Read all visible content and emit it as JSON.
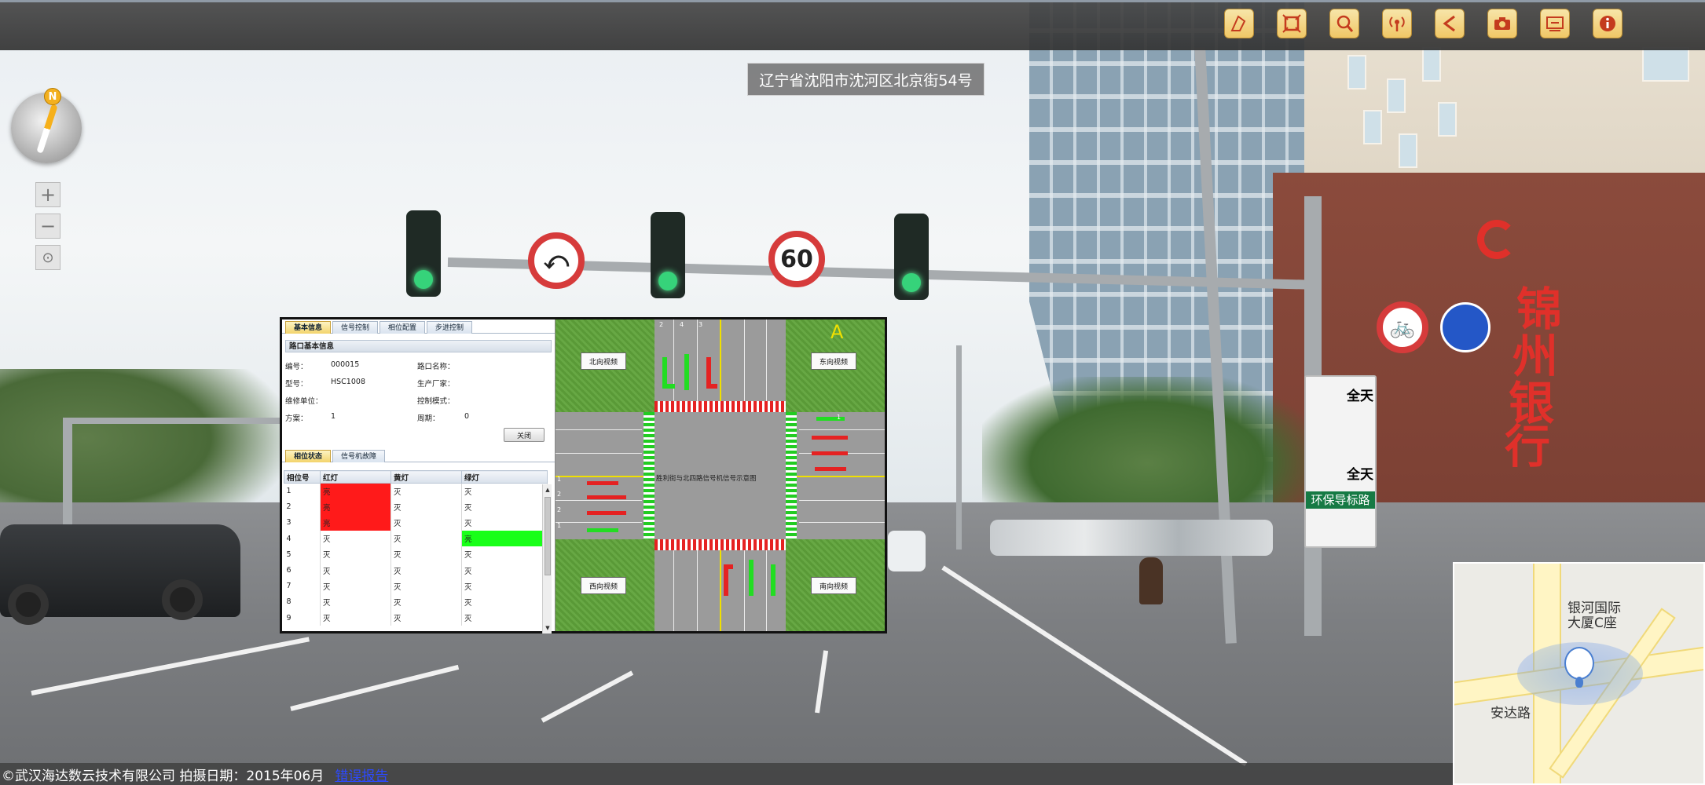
{
  "toolbar": {
    "buttons": [
      {
        "name": "measure-icon"
      },
      {
        "name": "fullscreen-icon"
      },
      {
        "name": "search-zoom-icon"
      },
      {
        "name": "broadcast-icon"
      },
      {
        "name": "share-icon"
      },
      {
        "name": "camera-icon"
      },
      {
        "name": "settings-panel-icon"
      },
      {
        "name": "info-icon"
      }
    ]
  },
  "address": "辽宁省沈阳市沈河区北京街54号",
  "compass": {
    "north_label": "N"
  },
  "zoom": {
    "in": "+",
    "out": "−",
    "reset": "⊙"
  },
  "street_signs": {
    "speed_limit": "60",
    "all_day_1": "全天",
    "all_day_2": "全天",
    "env_lane": "环保导标路"
  },
  "bank_sign": [
    "锦",
    "州",
    "银",
    "行"
  ],
  "signal_panel": {
    "tabs": [
      "基本信息",
      "信号控制",
      "相位配置",
      "步进控制"
    ],
    "section_title": "路口基本信息",
    "fields": {
      "number_label": "编号：",
      "number_value": "000015",
      "crossing_name_label": "路口名称：",
      "crossing_name_value": "",
      "model_label": "型号：",
      "model_value": "HSC1008",
      "manufacturer_label": "生产厂家：",
      "manufacturer_value": "",
      "maintenance_label": "维修单位：",
      "maintenance_value": "",
      "control_mode_label": "控制模式：",
      "control_mode_value": "",
      "plan_label": "方案：",
      "plan_value": "1",
      "cycle_label": "周期：",
      "cycle_value": "0"
    },
    "close_button": "关闭",
    "sub_tabs": [
      "相位状态",
      "信号机故障"
    ],
    "table": {
      "headers": [
        "相位号",
        "红灯",
        "黄灯",
        "绿灯"
      ],
      "rows": [
        {
          "id": "1",
          "red": "亮",
          "yellow": "灭",
          "green": "灭"
        },
        {
          "id": "2",
          "red": "亮",
          "yellow": "灭",
          "green": "灭"
        },
        {
          "id": "3",
          "red": "亮",
          "yellow": "灭",
          "green": "灭"
        },
        {
          "id": "4",
          "red": "灭",
          "yellow": "灭",
          "green": "亮"
        },
        {
          "id": "5",
          "red": "灭",
          "yellow": "灭",
          "green": "灭"
        },
        {
          "id": "6",
          "red": "灭",
          "yellow": "灭",
          "green": "灭"
        },
        {
          "id": "7",
          "red": "灭",
          "yellow": "灭",
          "green": "灭"
        },
        {
          "id": "8",
          "red": "灭",
          "yellow": "灭",
          "green": "灭"
        },
        {
          "id": "9",
          "red": "灭",
          "yellow": "灭",
          "green": "灭"
        }
      ]
    },
    "diagram": {
      "north_video": "北向视频",
      "east_video": "东向视频",
      "west_video": "西向视频",
      "south_video": "南向视频",
      "caption": "胜利街与北四路信号机信号示意图",
      "lane_numbers_top": [
        "2",
        "4",
        "3"
      ],
      "lane_numbers_left": [
        "1",
        "2",
        "2",
        "1"
      ],
      "lane_numbers_right": [
        "1"
      ]
    }
  },
  "minimap": {
    "label_building": "银河国际\n大厦C座",
    "label_road": "安达路"
  },
  "footer": {
    "copyright": "©武汉海达数云技术有限公司 拍摄日期：2015年06月",
    "report_link": "错误报告"
  }
}
